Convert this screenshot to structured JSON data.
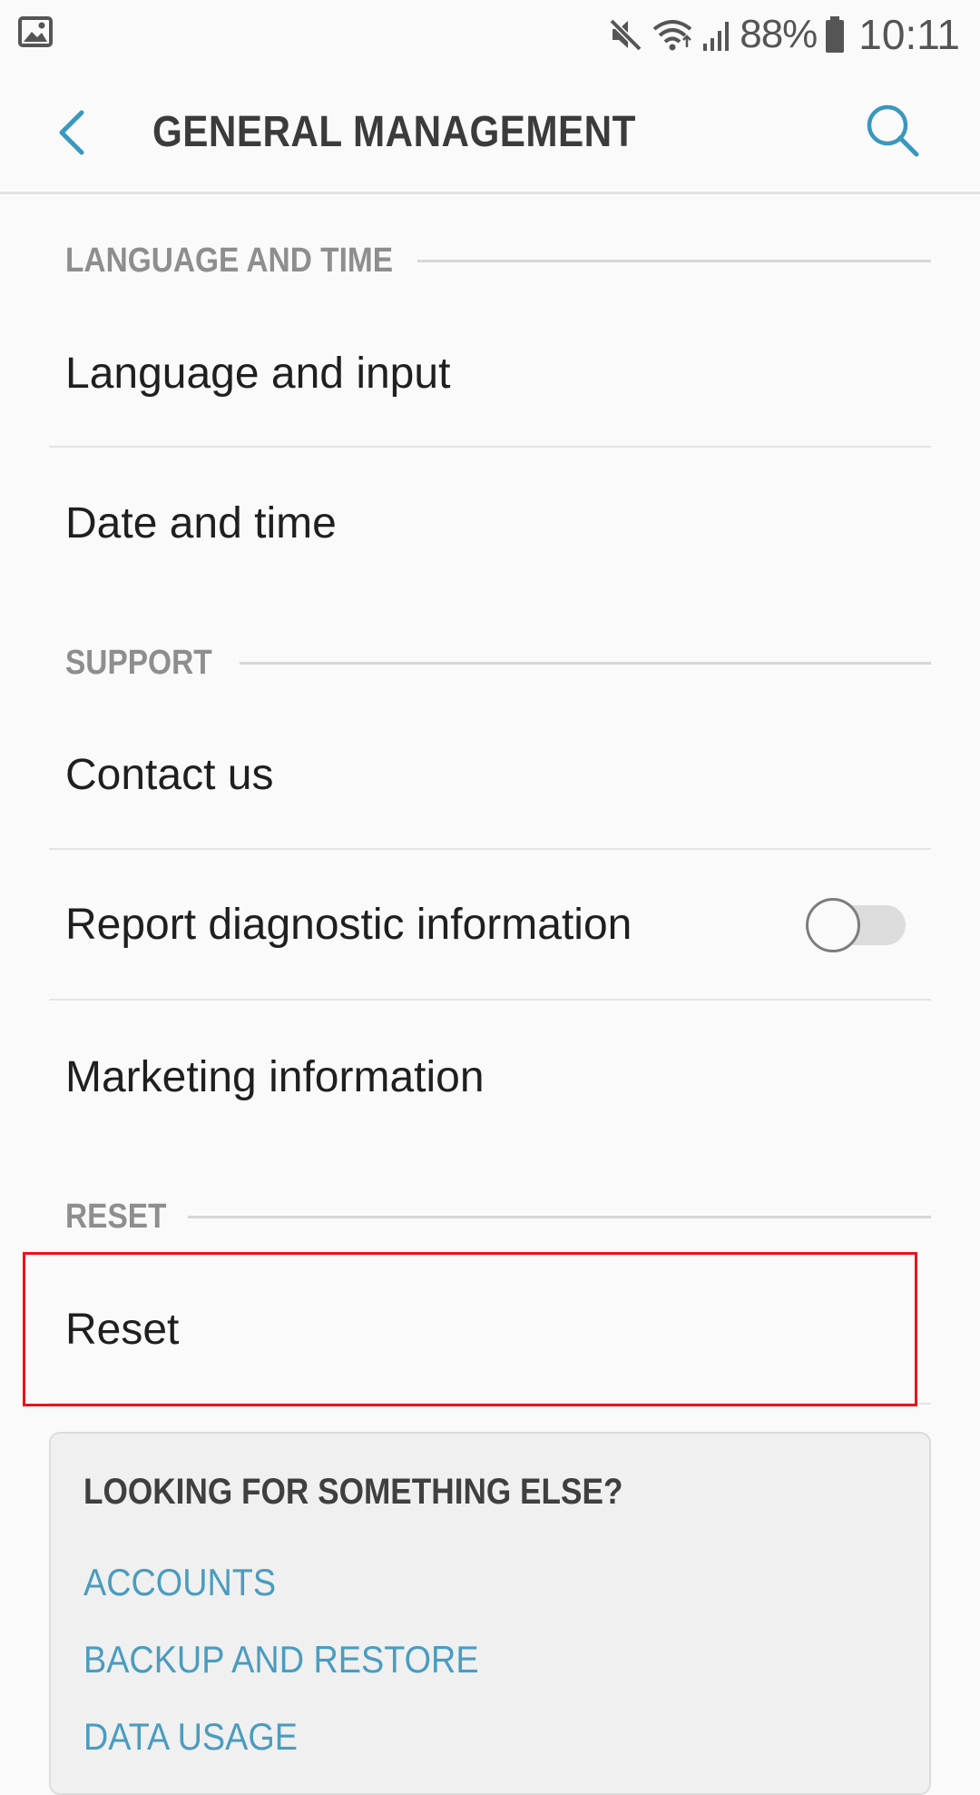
{
  "status_bar": {
    "battery": "88%",
    "time": "10:11",
    "icons": [
      "gallery-icon",
      "mute-icon",
      "wifi-icon",
      "signal-icon",
      "battery-icon"
    ]
  },
  "header": {
    "title": "GENERAL MANAGEMENT",
    "back_icon": "chevron-left-icon",
    "search_icon": "search-icon"
  },
  "sections": {
    "language_time": {
      "title": "LANGUAGE AND TIME",
      "items": [
        "Language and input",
        "Date and time"
      ]
    },
    "support": {
      "title": "SUPPORT",
      "items": [
        "Contact us",
        "Report diagnostic information",
        "Marketing information"
      ]
    },
    "reset": {
      "title": "RESET",
      "items": [
        "Reset"
      ]
    }
  },
  "toggles": {
    "report_diagnostic": {
      "state": "off"
    }
  },
  "card": {
    "title": "LOOKING FOR SOMETHING ELSE?",
    "links": [
      "ACCOUNTS",
      "BACKUP AND RESTORE",
      "DATA USAGE"
    ]
  },
  "colors": {
    "accent": "#4a9cbf",
    "highlight": "#e8141b",
    "section_header": "#8e8e8e",
    "background": "#fafafa"
  }
}
